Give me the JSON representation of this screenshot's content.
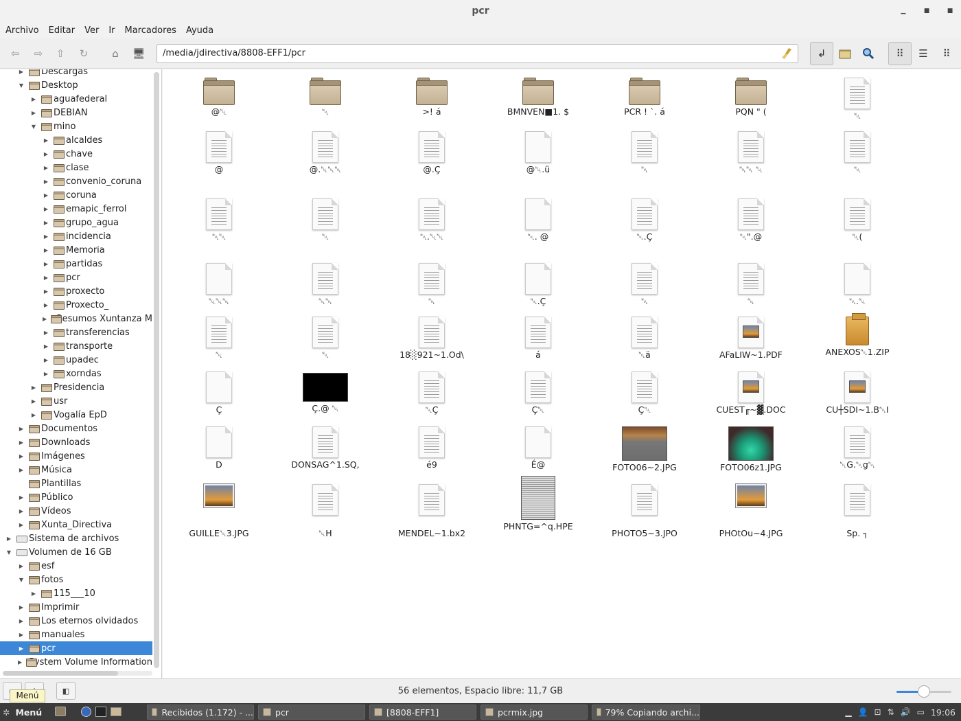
{
  "window": {
    "title": "pcr"
  },
  "menubar": [
    "Archivo",
    "Editar",
    "Ver",
    "Ir",
    "Marcadores",
    "Ayuda"
  ],
  "toolbar": {
    "location": "/media/jdirectiva/8808-EFF1/pcr",
    "icons": [
      "back-icon",
      "forward-icon",
      "up-icon",
      "reload-icon",
      "home-icon",
      "computer-icon"
    ],
    "right_icons": [
      "location-toggle-icon",
      "new-folder-icon",
      "search-icon",
      "icon-view-icon",
      "list-view-icon",
      "compact-view-icon"
    ]
  },
  "sidebar": {
    "items": [
      {
        "label": "Descargas",
        "indent": 1,
        "arrow": "right"
      },
      {
        "label": "Desktop",
        "indent": 1,
        "arrow": "down"
      },
      {
        "label": "aguafederal",
        "indent": 2,
        "arrow": "right"
      },
      {
        "label": "DEBIAN",
        "indent": 2,
        "arrow": "right"
      },
      {
        "label": "mino",
        "indent": 2,
        "arrow": "down"
      },
      {
        "label": "alcaldes",
        "indent": 3,
        "arrow": "right"
      },
      {
        "label": "chave",
        "indent": 3,
        "arrow": "right"
      },
      {
        "label": "clase",
        "indent": 3,
        "arrow": "right"
      },
      {
        "label": "convenio_coruna",
        "indent": 3,
        "arrow": "right"
      },
      {
        "label": "coruna",
        "indent": 3,
        "arrow": "right"
      },
      {
        "label": "emapic_ferrol",
        "indent": 3,
        "arrow": "right"
      },
      {
        "label": "grupo_agua",
        "indent": 3,
        "arrow": "right"
      },
      {
        "label": "incidencia",
        "indent": 3,
        "arrow": "right"
      },
      {
        "label": "Memoria",
        "indent": 3,
        "arrow": "right"
      },
      {
        "label": "partidas",
        "indent": 3,
        "arrow": "right"
      },
      {
        "label": "pcr",
        "indent": 3,
        "arrow": "right"
      },
      {
        "label": "proxecto",
        "indent": 3,
        "arrow": "right"
      },
      {
        "label": "Proxecto_",
        "indent": 3,
        "arrow": "right"
      },
      {
        "label": "Resumos Xuntanza M",
        "indent": 3,
        "arrow": "right"
      },
      {
        "label": "transferencias",
        "indent": 3,
        "arrow": "right"
      },
      {
        "label": "transporte",
        "indent": 3,
        "arrow": "right"
      },
      {
        "label": "upadec",
        "indent": 3,
        "arrow": "right"
      },
      {
        "label": "xorndas",
        "indent": 3,
        "arrow": "right"
      },
      {
        "label": "Presidencia",
        "indent": 2,
        "arrow": "right"
      },
      {
        "label": "usr",
        "indent": 2,
        "arrow": "right"
      },
      {
        "label": "Vogalía EpD",
        "indent": 2,
        "arrow": "right"
      },
      {
        "label": "Documentos",
        "indent": 1,
        "arrow": "right"
      },
      {
        "label": "Downloads",
        "indent": 1,
        "arrow": "right"
      },
      {
        "label": "Imágenes",
        "indent": 1,
        "arrow": "right"
      },
      {
        "label": "Música",
        "indent": 1,
        "arrow": "right"
      },
      {
        "label": "Plantillas",
        "indent": 1,
        "arrow": "none"
      },
      {
        "label": "Público",
        "indent": 1,
        "arrow": "right"
      },
      {
        "label": "Vídeos",
        "indent": 1,
        "arrow": "right"
      },
      {
        "label": "Xunta_Directiva",
        "indent": 1,
        "arrow": "right"
      },
      {
        "label": "Sistema de archivos",
        "indent": 0,
        "arrow": "right",
        "icon": "drive"
      },
      {
        "label": "Volumen de 16 GB",
        "indent": 0,
        "arrow": "down",
        "icon": "drive"
      },
      {
        "label": "esf",
        "indent": 1,
        "arrow": "right"
      },
      {
        "label": "fotos",
        "indent": 1,
        "arrow": "down"
      },
      {
        "label": "115___10",
        "indent": 2,
        "arrow": "right"
      },
      {
        "label": "Imprimir",
        "indent": 1,
        "arrow": "right"
      },
      {
        "label": "Los eternos olvidados",
        "indent": 1,
        "arrow": "right"
      },
      {
        "label": "manuales",
        "indent": 1,
        "arrow": "right"
      },
      {
        "label": "pcr",
        "indent": 1,
        "arrow": "right",
        "selected": true
      },
      {
        "label": "System Volume Information",
        "indent": 1,
        "arrow": "right"
      }
    ]
  },
  "files": [
    {
      "name": "@␀",
      "type": "folder"
    },
    {
      "name": "␀",
      "type": "folder"
    },
    {
      "name": ">! á",
      "type": "folder"
    },
    {
      "name": "BMNVEN■1. $",
      "type": "folder"
    },
    {
      "name": "PCR !  `. á",
      "type": "folder"
    },
    {
      "name": "PQN \" (",
      "type": "folder"
    },
    {
      "name": "␀",
      "type": "doc"
    },
    {
      "name": "@",
      "type": "doc"
    },
    {
      "name": "@.␀␀␀",
      "type": "doc"
    },
    {
      "name": "@.Ç",
      "type": "doc"
    },
    {
      "name": "@␀.ü",
      "type": "blank"
    },
    {
      "name": "␀",
      "type": "doc"
    },
    {
      "name": "␀␀ ␀",
      "type": "doc"
    },
    {
      "name": "␀",
      "type": "doc"
    },
    {
      "name": "␀␀",
      "type": "doc"
    },
    {
      "name": "␀",
      "type": "doc"
    },
    {
      "name": "␀.␀␀",
      "type": "doc"
    },
    {
      "name": "␀. @",
      "type": "blank"
    },
    {
      "name": "␀.Ç",
      "type": "doc"
    },
    {
      "name": "␀\".@",
      "type": "doc"
    },
    {
      "name": "␀(",
      "type": "doc"
    },
    {
      "name": "␀␀␀",
      "type": "blank"
    },
    {
      "name": "␀␀",
      "type": "doc"
    },
    {
      "name": "␀",
      "type": "doc"
    },
    {
      "name": "␀.Ç",
      "type": "blank"
    },
    {
      "name": "␀",
      "type": "doc"
    },
    {
      "name": "␀",
      "type": "doc"
    },
    {
      "name": "␀.␀",
      "type": "blank"
    },
    {
      "name": "␀",
      "type": "doc"
    },
    {
      "name": "␀",
      "type": "doc"
    },
    {
      "name": "18░921~1.Od\\",
      "type": "doc"
    },
    {
      "name": "á",
      "type": "doc"
    },
    {
      "name": "␀ä",
      "type": "doc"
    },
    {
      "name": "AFaLIW~1.PDF",
      "type": "pic-doc"
    },
    {
      "name": "ANEXOS␀1.ZIP",
      "type": "zip"
    },
    {
      "name": "Ç",
      "type": "blank"
    },
    {
      "name": "Ç.@ ␀",
      "type": "black-image"
    },
    {
      "name": "␀Ç",
      "type": "doc"
    },
    {
      "name": "Ç␀",
      "type": "doc"
    },
    {
      "name": "Ç␀",
      "type": "doc"
    },
    {
      "name": "CUEST╓~▓.DOC",
      "type": "pic-doc"
    },
    {
      "name": "CU┼SDI~1.B␀I",
      "type": "pic-doc"
    },
    {
      "name": "D",
      "type": "blank"
    },
    {
      "name": "DONSAG^1.SQ,",
      "type": "doc"
    },
    {
      "name": "é9",
      "type": "doc"
    },
    {
      "name": "É@",
      "type": "blank"
    },
    {
      "name": "FOTO06~2.JPG",
      "type": "photo-a"
    },
    {
      "name": "FOTO06z1.JPG",
      "type": "photo-b"
    },
    {
      "name": "␀G.␀g␀",
      "type": "doc"
    },
    {
      "name": "GUILLE␀3.JPG",
      "type": "pic-small"
    },
    {
      "name": "␀H",
      "type": "doc"
    },
    {
      "name": "MENDEL~1.bx2",
      "type": "doc"
    },
    {
      "name": "PHNTG=^q.HPE",
      "type": "photo-news"
    },
    {
      "name": "PHOTO5~3.JPO",
      "type": "doc"
    },
    {
      "name": "PHOtOu~4.JPG",
      "type": "pic-small"
    },
    {
      "name": "Sp. ┐",
      "type": "doc"
    }
  ],
  "status": {
    "text": "56 elementos, Espacio libre: 11,7 GB",
    "zoom_level": 0.5
  },
  "tooltip": "Menú",
  "taskbar": {
    "menu_label": "Menú",
    "tasks": [
      "Recibidos (1.172) - ...",
      "pcr",
      "[8808-EFF1]",
      "pcrmix.jpg",
      "79% Copiando archi..."
    ],
    "clock": "19:06"
  }
}
